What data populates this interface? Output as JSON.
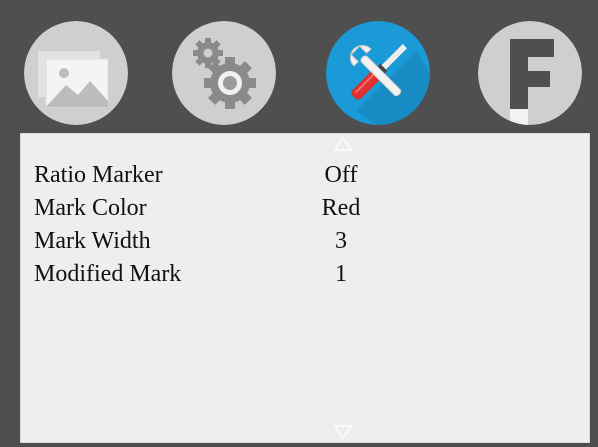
{
  "tabs": [
    {
      "icon": "picture-icon",
      "active": false
    },
    {
      "icon": "gears-icon",
      "active": false
    },
    {
      "icon": "tools-icon",
      "active": true
    },
    {
      "icon": "function-icon",
      "label": "F",
      "active": false
    }
  ],
  "colors": {
    "background": "#4f4f4f",
    "tab_inactive": "#cfcfcf",
    "tab_active": "#1a9ad6",
    "panel": "#efedee",
    "text": "#111111"
  },
  "menu": {
    "scroll_up_icon": "scroll-up-arrow-icon",
    "scroll_down_icon": "scroll-down-arrow-icon",
    "items": [
      {
        "label": "Ratio Marker",
        "value": "Off"
      },
      {
        "label": "Mark Color",
        "value": "Red"
      },
      {
        "label": "Mark Width",
        "value": "3"
      },
      {
        "label": "Modified Mark",
        "value": "1"
      }
    ]
  }
}
